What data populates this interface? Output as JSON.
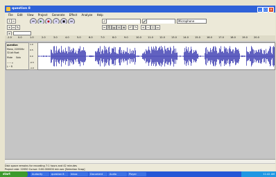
{
  "window": {
    "title": "question 8",
    "minimize": "_",
    "maximize": "□",
    "close": "×"
  },
  "menu": [
    "File",
    "Edit",
    "View",
    "Project",
    "Generate",
    "Effect",
    "Analyze",
    "Help"
  ],
  "toolbar": {
    "input_source": "Microphone"
  },
  "ruler_ticks": [
    "-1.0",
    "0.0",
    "1.0",
    "2.0",
    "3.0",
    "4.0",
    "5.0",
    "6.0",
    "7.0",
    "8.0",
    "9.0",
    "10.0",
    "11.0",
    "12.0",
    "13.0",
    "14.0",
    "15.0",
    "16.0",
    "17.0",
    "18.0",
    "19.0",
    "20.0"
  ],
  "track": {
    "name": "question",
    "info1": "Mono, 22050Hz",
    "info2": "32-bit float",
    "mute": "Mute",
    "solo": "Solo",
    "scale": [
      "1.0",
      "0.5",
      "0.0",
      "-0.5",
      "-1.0"
    ]
  },
  "status": {
    "line1": "Disk space remains for recording 7:1 hours and 42 minutes",
    "line2": "Project rate: 22050   Cursor: 0:00.000000 min:sec  [Selection Snap]"
  },
  "taskbar": {
    "start": "start",
    "items": [
      "Audacity",
      "question 8",
      "Inbox",
      "Document",
      "Audio",
      "Player"
    ],
    "clock": "11:42 AM"
  }
}
